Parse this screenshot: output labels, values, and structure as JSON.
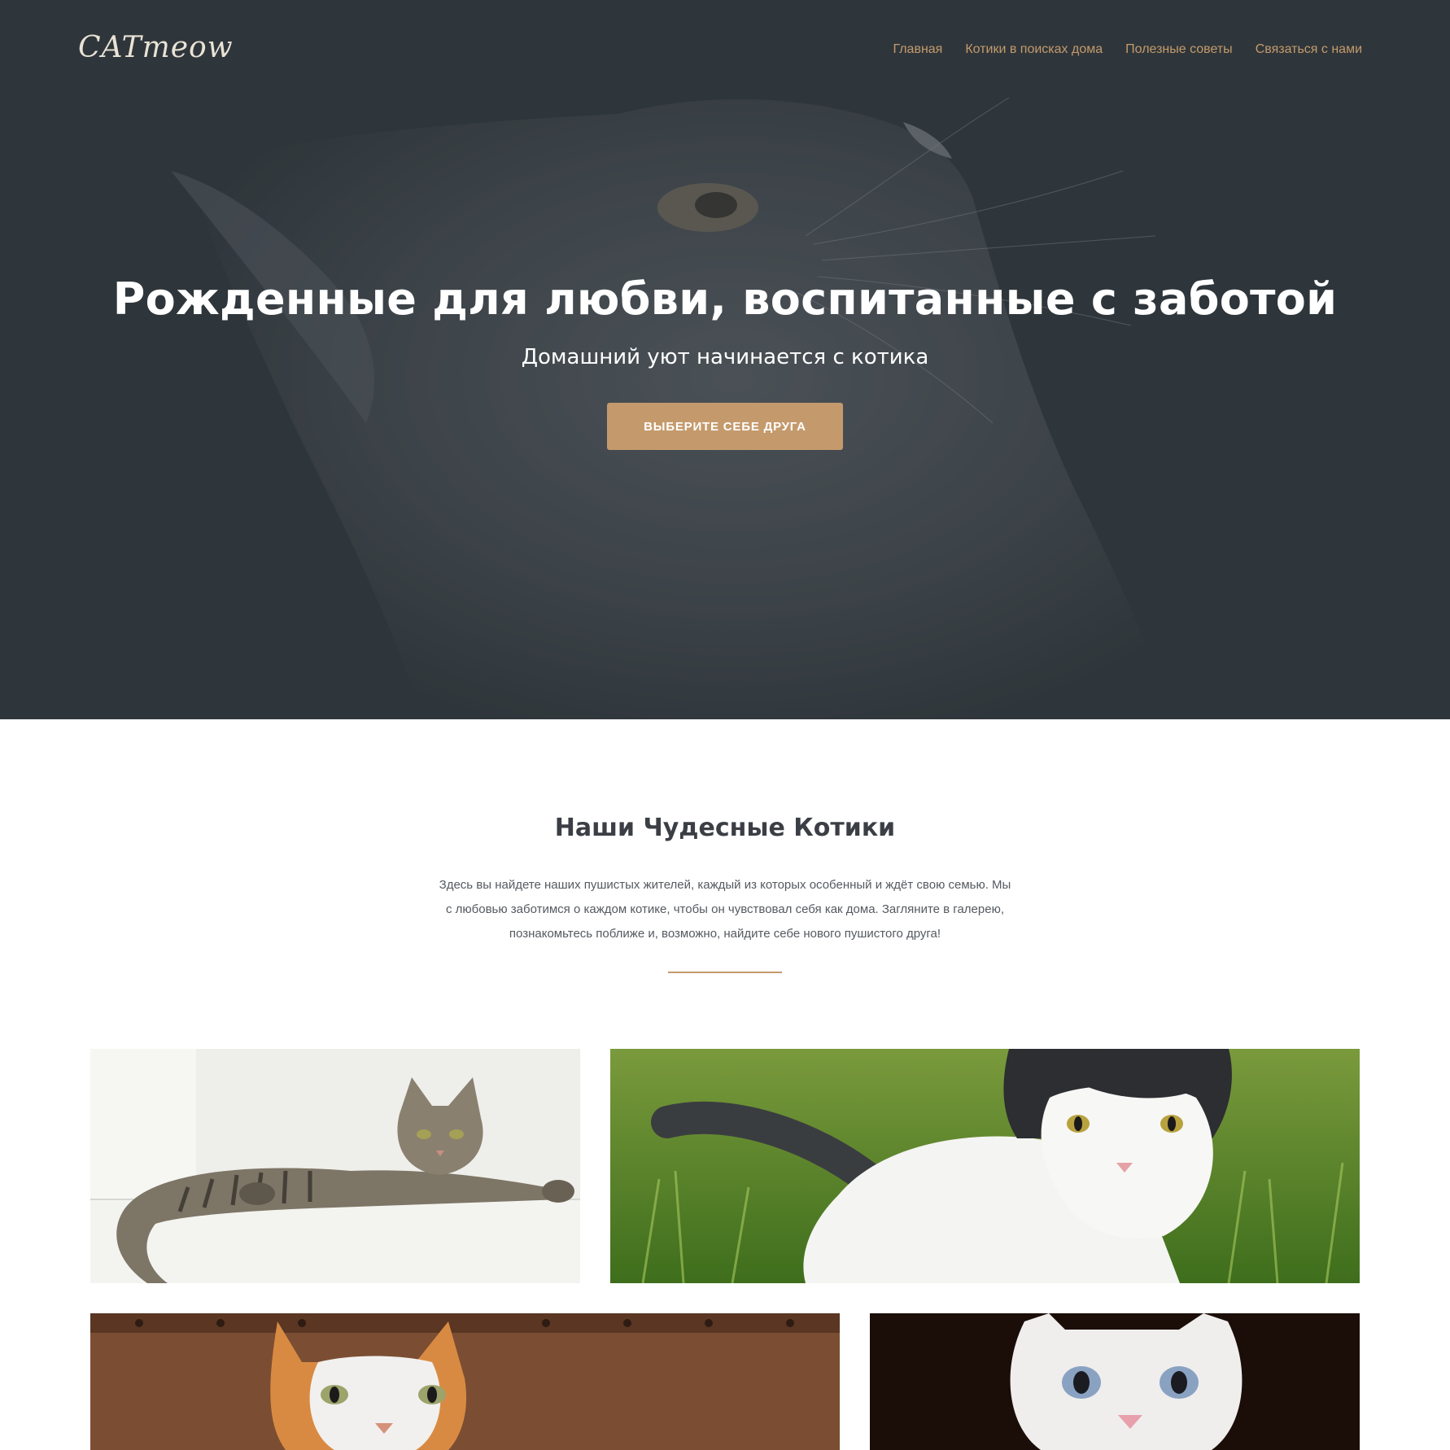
{
  "header": {
    "logo": "CATmeow",
    "nav": [
      {
        "label": "Главная"
      },
      {
        "label": "Котики в поисках дома"
      },
      {
        "label": "Полезные советы"
      },
      {
        "label": "Связаться с нами"
      }
    ]
  },
  "hero": {
    "title": "Рожденные для любви, воспитанные с заботой",
    "subtitle": "Домашний уют начинается с котика",
    "button_label": "ВЫБЕРИТЕ СЕБЕ ДРУГА"
  },
  "about": {
    "title": "Наши Чудесные Котики",
    "text_lines": [
      "Здесь вы найдете наших пушистых жителей, каждый из которых особенный и ждёт свою семью. Мы",
      "с любовью заботимся о каждом котике, чтобы он чувствовал себя как дома. Загляните в галерею,",
      "познакомьтесь поближе и, возможно, найдите себе нового пушистого друга!"
    ]
  },
  "colors": {
    "accent": "#c49a6c",
    "hero_bg": "#2f363b",
    "heading": "#3b3f45",
    "body_text": "#555a60"
  },
  "icons": [
    "cat-photo-tabby",
    "cat-photo-black-white",
    "cat-photo-ginger",
    "cat-photo-white-kitten"
  ]
}
